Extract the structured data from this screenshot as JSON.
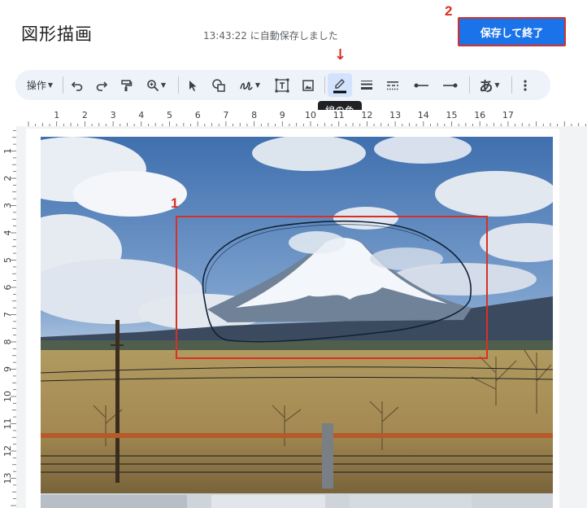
{
  "header": {
    "title": "図形描画",
    "autosave_status": "13:43:22 に自動保存しました",
    "save_close_label": "保存して終了"
  },
  "annotations": {
    "step1": "1",
    "step2": "2",
    "arrow": "↓"
  },
  "toolbar": {
    "actions_label": "操作",
    "tools": [
      "undo-icon",
      "redo-icon",
      "paint-format-icon",
      "zoom-icon",
      "select-icon",
      "shape-icon",
      "scribble-icon",
      "text-box-icon",
      "image-icon",
      "line-color-icon",
      "line-weight-icon",
      "line-dash-icon",
      "line-start-icon",
      "line-end-icon",
      "font-icon",
      "more-icon"
    ],
    "font_label": "あ",
    "line_color": "#000000",
    "active_tool": "line-color"
  },
  "tooltip": {
    "text": "線の色"
  },
  "ruler": {
    "horizontal": [
      "1",
      "2",
      "3",
      "4",
      "5",
      "6",
      "7",
      "8",
      "9",
      "10",
      "11",
      "12",
      "13",
      "14",
      "15",
      "16",
      "17"
    ],
    "vertical": [
      "1",
      "2",
      "3",
      "4",
      "5",
      "6",
      "7",
      "8",
      "9",
      "10",
      "11",
      "12",
      "13"
    ]
  },
  "colors": {
    "accent": "#1a73e8",
    "annotation_red": "#d93025",
    "toolbar_bg": "#eef2f9"
  }
}
